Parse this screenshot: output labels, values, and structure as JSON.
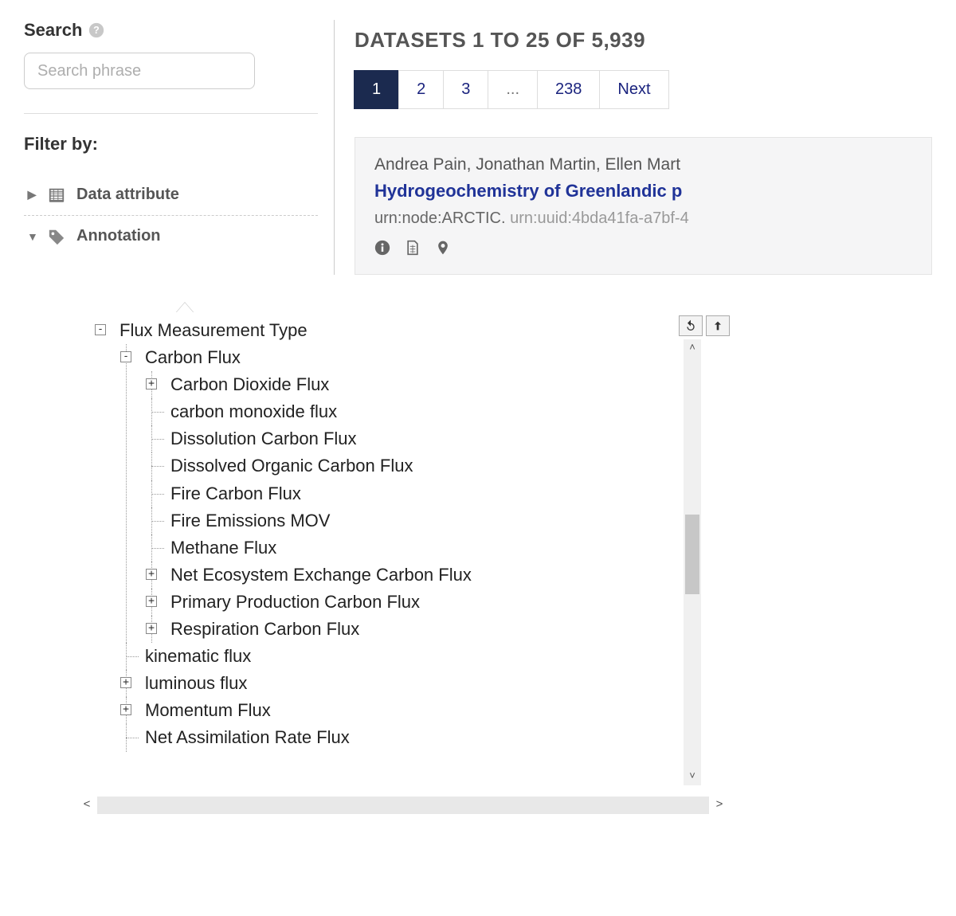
{
  "sidebar": {
    "search_label": "Search",
    "search_placeholder": "Search phrase",
    "filter_heading": "Filter by:",
    "filters": [
      {
        "label": "Data attribute",
        "expanded": false
      },
      {
        "label": "Annotation",
        "expanded": true
      }
    ]
  },
  "results": {
    "heading": "DATASETS 1 TO 25 OF 5,939",
    "pages": [
      "1",
      "2",
      "3",
      "...",
      "238",
      "Next"
    ],
    "active_page": "1",
    "card": {
      "authors": "Andrea Pain, Jonathan Martin, Ellen Mart",
      "title": "Hydrogeochemistry of Greenlandic p",
      "urn_primary": "urn:node:ARCTIC.",
      "urn_secondary": "urn:uuid:4bda41fa-a7bf-4"
    }
  },
  "tree": {
    "root": "Flux Measurement Type",
    "nodes": [
      {
        "label": "Carbon Flux",
        "expander": "-",
        "children": [
          {
            "label": "Carbon Dioxide Flux",
            "expander": "+"
          },
          {
            "label": "carbon monoxide flux"
          },
          {
            "label": "Dissolution Carbon Flux"
          },
          {
            "label": "Dissolved Organic Carbon Flux"
          },
          {
            "label": "Fire Carbon Flux"
          },
          {
            "label": "Fire Emissions MOV"
          },
          {
            "label": "Methane Flux"
          },
          {
            "label": "Net Ecosystem Exchange Carbon Flux",
            "expander": "+"
          },
          {
            "label": "Primary Production Carbon Flux",
            "expander": "+"
          },
          {
            "label": "Respiration Carbon Flux",
            "expander": "+"
          }
        ]
      },
      {
        "label": "kinematic flux"
      },
      {
        "label": "luminous flux",
        "expander": "+"
      },
      {
        "label": "Momentum Flux",
        "expander": "+"
      },
      {
        "label": "Net Assimilation Rate Flux"
      }
    ]
  }
}
